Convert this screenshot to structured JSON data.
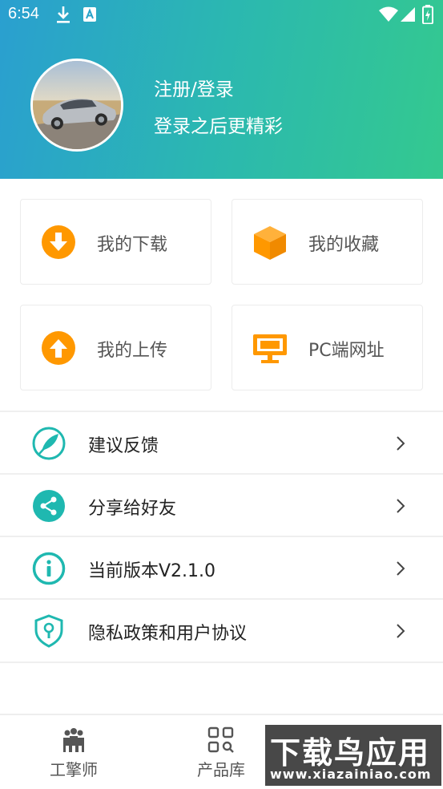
{
  "status_bar": {
    "time": "6:54"
  },
  "profile": {
    "login_label": "注册/登录",
    "subtitle": "登录之后更精彩"
  },
  "cards": [
    {
      "label": "我的下载",
      "icon": "download-circle-icon"
    },
    {
      "label": "我的收藏",
      "icon": "box-icon"
    },
    {
      "label": "我的上传",
      "icon": "upload-circle-icon"
    },
    {
      "label": "PC端网址",
      "icon": "monitor-icon"
    }
  ],
  "menu": [
    {
      "label": "建议反馈",
      "icon": "feather-icon"
    },
    {
      "label": "分享给好友",
      "icon": "share-icon"
    },
    {
      "label": "当前版本V2.1.0",
      "icon": "info-icon"
    },
    {
      "label": "隐私政策和用户协议",
      "icon": "shield-keyhole-icon"
    }
  ],
  "bottom_nav": [
    {
      "label": "工擎师",
      "icon": "people-icon"
    },
    {
      "label": "产品库",
      "icon": "grid-search-icon"
    }
  ],
  "watermark": {
    "main": "下载鸟应用",
    "sub": "www.xiazainiao.com"
  },
  "colors": {
    "header_start": "#2a9fd0",
    "header_end": "#34c98f",
    "card_icon": "#ff9800",
    "menu_icon": "#1fb8b0"
  }
}
